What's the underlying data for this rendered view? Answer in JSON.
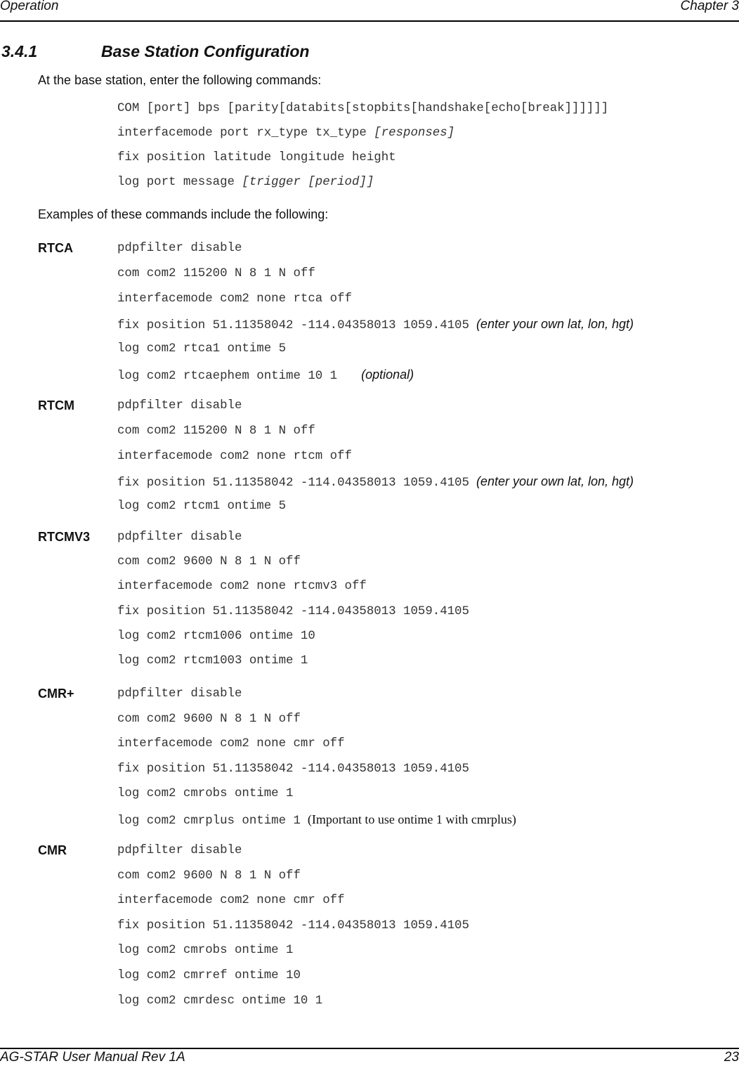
{
  "header": {
    "left": "Operation",
    "right": "Chapter 3"
  },
  "section": {
    "number": "3.4.1",
    "title": "Base Station Configuration"
  },
  "intro": "At the base station, enter the following commands:",
  "syntax": [
    {
      "text": "COM [port] bps [parity[databits[stopbits[handshake[echo[break]]]]]]",
      "italic": ""
    },
    {
      "text": "interfacemode port rx_type tx_type ",
      "italic": "[responses]"
    },
    {
      "text": "fix position latitude longitude height",
      "italic": ""
    },
    {
      "text": "log port message ",
      "italic": "[trigger [period]]"
    }
  ],
  "examples_intro": "Examples of these commands include the following:",
  "groups": [
    {
      "label": "RTCA",
      "lines": [
        {
          "cmd": "pdpfilter disable",
          "note": ""
        },
        {
          "cmd": "com com2 115200 N 8 1 N off",
          "note": ""
        },
        {
          "cmd": "interfacemode com2 none rtca off",
          "note": ""
        },
        {
          "cmd": "fix position 51.11358042 -114.04358013 1059.4105",
          "note": "(enter your own lat, lon, hgt)"
        },
        {
          "cmd": "log com2 rtca1 ontime 5",
          "note": ""
        },
        {
          "cmd": "log com2 rtcaephem ontime 10 1",
          "note": "(optional)"
        }
      ]
    },
    {
      "label": "RTCM",
      "lines": [
        {
          "cmd": "pdpfilter disable",
          "note": ""
        },
        {
          "cmd": "com com2 115200 N 8 1 N off",
          "note": ""
        },
        {
          "cmd": "interfacemode com2 none rtcm off",
          "note": ""
        },
        {
          "cmd": "fix position 51.11358042 -114.04358013 1059.4105",
          "note": "(enter your own lat, lon, hgt)"
        },
        {
          "cmd": "log com2 rtcm1 ontime 5",
          "note": ""
        }
      ]
    },
    {
      "label": "RTCMV3",
      "lines": [
        {
          "cmd": "pdpfilter disable",
          "note": ""
        },
        {
          "cmd": "com com2 9600 N 8 1 N off",
          "note": ""
        },
        {
          "cmd": "interfacemode com2 none rtcmv3 off",
          "note": ""
        },
        {
          "cmd": "fix position 51.11358042 -114.04358013 1059.4105",
          "note": ""
        },
        {
          "cmd": "log com2 rtcm1006 ontime 10",
          "note": ""
        },
        {
          "cmd": "log com2 rtcm1003 ontime 1",
          "note": ""
        }
      ]
    },
    {
      "label": "CMR+",
      "lines": [
        {
          "cmd": "pdpfilter disable",
          "note": ""
        },
        {
          "cmd": "com com2 9600 N 8 1 N off",
          "note": ""
        },
        {
          "cmd": "interfacemode com2 none cmr off",
          "note": ""
        },
        {
          "cmd": "fix position 51.11358042 -114.04358013 1059.4105",
          "note": ""
        },
        {
          "cmd": "log com2 cmrobs ontime 1",
          "note": ""
        },
        {
          "cmd": "log com2 cmrplus ontime 1",
          "note_serif": "(Important to use ontime 1 with cmrplus)"
        }
      ]
    },
    {
      "label": "CMR",
      "lines": [
        {
          "cmd": "pdpfilter disable",
          "note": ""
        },
        {
          "cmd": "com com2 9600 N 8 1 N off",
          "note": ""
        },
        {
          "cmd": "interfacemode com2 none cmr off",
          "note": ""
        },
        {
          "cmd": "fix position 51.11358042 -114.04358013 1059.4105",
          "note": ""
        },
        {
          "cmd": "log com2 cmrobs ontime 1",
          "note": ""
        },
        {
          "cmd": "log com2 cmrref ontime 10",
          "note": ""
        },
        {
          "cmd": "log com2 cmrdesc ontime 10 1",
          "note": ""
        }
      ]
    }
  ],
  "footer": {
    "left": "AG-STAR User Manual Rev 1A",
    "right": "23"
  }
}
